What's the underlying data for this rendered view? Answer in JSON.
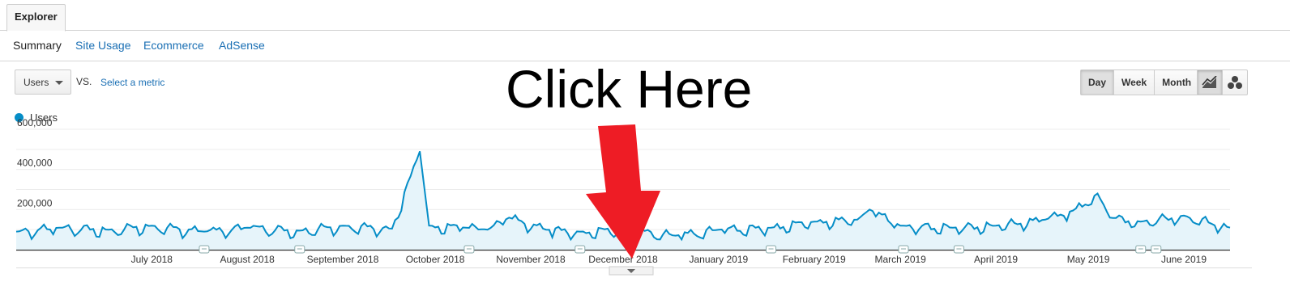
{
  "tabs": [
    {
      "label": "Explorer"
    }
  ],
  "subnav": {
    "items": [
      "Summary",
      "Site Usage",
      "Ecommerce",
      "AdSense"
    ]
  },
  "controls": {
    "metric": "Users",
    "vs": "VS.",
    "select_metric": "Select a metric",
    "granularity": [
      "Day",
      "Week",
      "Month"
    ],
    "active_granularity": "Day"
  },
  "icons": [
    "line-chart-icon",
    "motion-chart-icon",
    "annotation-icon",
    "expand-arrow-icon"
  ],
  "overlay": {
    "text": "Click Here",
    "arrow_color": "#ee1c25"
  },
  "colors": {
    "series": "#058dc7",
    "fill": "#e6f4fa",
    "link": "#1a6fb4"
  },
  "chart_data": {
    "type": "area",
    "legend": "Users",
    "y_ticks": [
      "600,000",
      "400,000",
      "200,000"
    ],
    "ylim": [
      0,
      600000
    ],
    "x_labels": [
      "July 2018",
      "August 2018",
      "September 2018",
      "October 2018",
      "November 2018",
      "December 2018",
      "January 2019",
      "February 2019",
      "March 2019",
      "April 2019",
      "May 2019",
      "June 2019"
    ],
    "x_range": [
      "2018-06-01",
      "2019-06-30"
    ],
    "series": [
      {
        "name": "Users",
        "points": [
          [
            "2018-06-01",
            90000
          ],
          [
            "2018-06-15",
            110000
          ],
          [
            "2018-07-01",
            100000
          ],
          [
            "2018-07-15",
            120000
          ],
          [
            "2018-08-01",
            90000
          ],
          [
            "2018-08-15",
            110000
          ],
          [
            "2018-09-01",
            95000
          ],
          [
            "2018-09-15",
            120000
          ],
          [
            "2018-10-01",
            105000
          ],
          [
            "2018-10-10",
            490000
          ],
          [
            "2018-10-13",
            120000
          ],
          [
            "2018-10-25",
            110000
          ],
          [
            "2018-11-01",
            100000
          ],
          [
            "2018-11-08",
            160000
          ],
          [
            "2018-11-20",
            100000
          ],
          [
            "2018-12-01",
            90000
          ],
          [
            "2018-12-15",
            100000
          ],
          [
            "2019-01-01",
            70000
          ],
          [
            "2019-01-15",
            100000
          ],
          [
            "2019-02-01",
            110000
          ],
          [
            "2019-02-15",
            140000
          ],
          [
            "2019-03-01",
            150000
          ],
          [
            "2019-03-05",
            200000
          ],
          [
            "2019-03-15",
            120000
          ],
          [
            "2019-04-01",
            110000
          ],
          [
            "2019-04-15",
            120000
          ],
          [
            "2019-05-01",
            150000
          ],
          [
            "2019-05-10",
            195000
          ],
          [
            "2019-05-18",
            280000
          ],
          [
            "2019-05-22",
            160000
          ],
          [
            "2019-06-01",
            140000
          ],
          [
            "2019-06-15",
            170000
          ],
          [
            "2019-06-30",
            110000
          ]
        ]
      }
    ]
  }
}
